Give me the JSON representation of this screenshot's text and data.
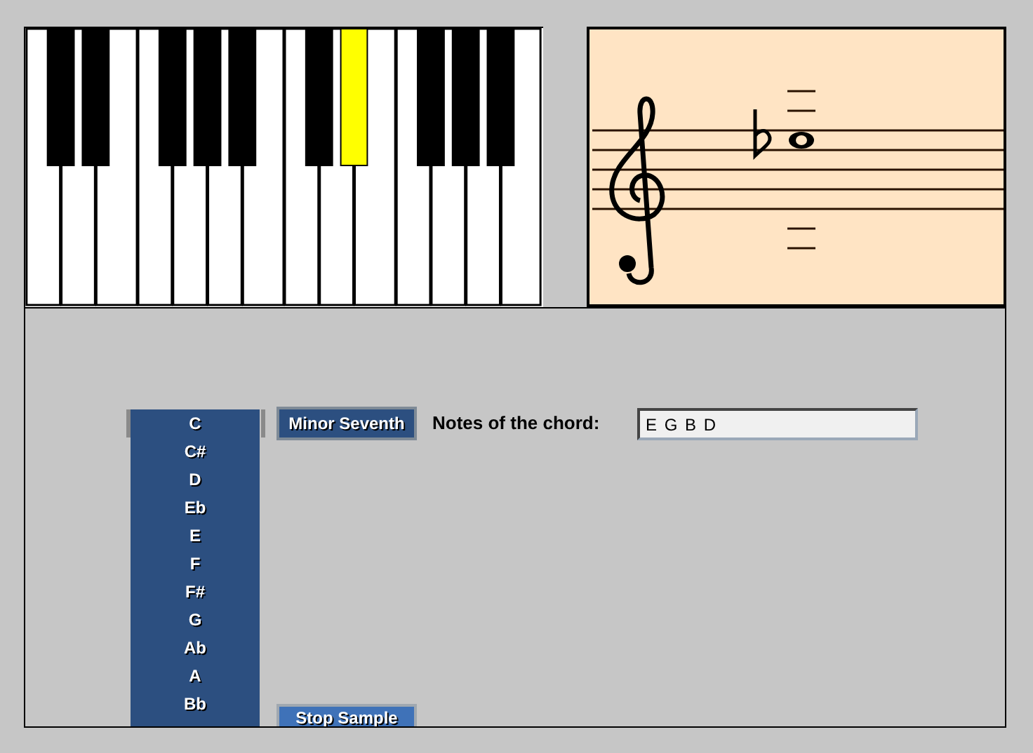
{
  "keyboard": {
    "keys": [
      {
        "kind": "white",
        "pressed": false
      },
      {
        "kind": "white",
        "pressed": false
      },
      {
        "kind": "white",
        "pressed": false
      },
      {
        "kind": "white",
        "pressed": false
      },
      {
        "kind": "white",
        "pressed": false
      },
      {
        "kind": "white",
        "pressed": false
      },
      {
        "kind": "white",
        "pressed": false
      },
      {
        "kind": "white",
        "pressed": false
      },
      {
        "kind": "white",
        "pressed": false
      },
      {
        "kind": "white",
        "pressed": false
      },
      {
        "kind": "white",
        "pressed": false
      },
      {
        "kind": "white",
        "pressed": false
      },
      {
        "kind": "white",
        "pressed": false
      },
      {
        "kind": "white",
        "pressed": false
      },
      {
        "kind": "black",
        "pressed": false
      },
      {
        "kind": "black",
        "pressed": false
      },
      {
        "kind": "black",
        "pressed": false
      },
      {
        "kind": "black",
        "pressed": false
      },
      {
        "kind": "black",
        "pressed": false
      },
      {
        "kind": "black",
        "pressed": false
      },
      {
        "kind": "black",
        "pressed": true
      },
      {
        "kind": "black",
        "pressed": false
      },
      {
        "kind": "black",
        "pressed": false
      },
      {
        "kind": "black",
        "pressed": false
      }
    ]
  },
  "root_list": {
    "items": [
      "C",
      "C#",
      "D",
      "Eb",
      "E",
      "F",
      "F#",
      "G",
      "Ab",
      "A",
      "Bb"
    ]
  },
  "chord_button": "Minor Seventh",
  "notes_label": "Notes of the chord:",
  "notes_field": {
    "value": "E G B D"
  },
  "stop_button": "Stop Sample"
}
